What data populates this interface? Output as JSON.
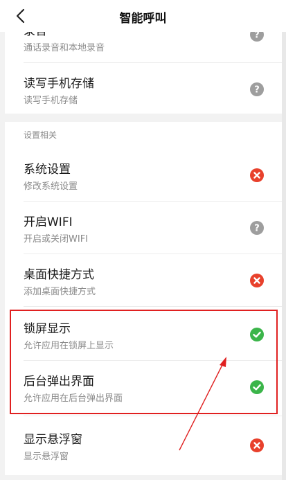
{
  "header": {
    "title": "智能呼叫"
  },
  "colors": {
    "ok": "#3bb54a",
    "denied": "#e8412c",
    "unknown": "#9e9e9e",
    "highlight": "#e02020"
  },
  "panel1": {
    "items": [
      {
        "title": "录音",
        "subtitle": "通话录音和本地录音",
        "status": "question-icon"
      },
      {
        "title": "读写手机存储",
        "subtitle": "读写手机存储",
        "status": "question-icon"
      }
    ]
  },
  "panel2": {
    "section_label": "设置相关",
    "items": [
      {
        "title": "系统设置",
        "subtitle": "修改系统设置",
        "status": "denied-icon"
      },
      {
        "title": "开启WIFI",
        "subtitle": "开启或关闭WIFI",
        "status": "question-icon"
      },
      {
        "title": "桌面快捷方式",
        "subtitle": "添加桌面快捷方式",
        "status": "denied-icon"
      },
      {
        "title": "锁屏显示",
        "subtitle": "允许应用在锁屏上显示",
        "status": "allowed-icon"
      },
      {
        "title": "后台弹出界面",
        "subtitle": "允许应用在后台弹出界面",
        "status": "allowed-icon"
      },
      {
        "title": "显示悬浮窗",
        "subtitle": "显示悬浮窗",
        "status": "denied-icon"
      }
    ]
  }
}
